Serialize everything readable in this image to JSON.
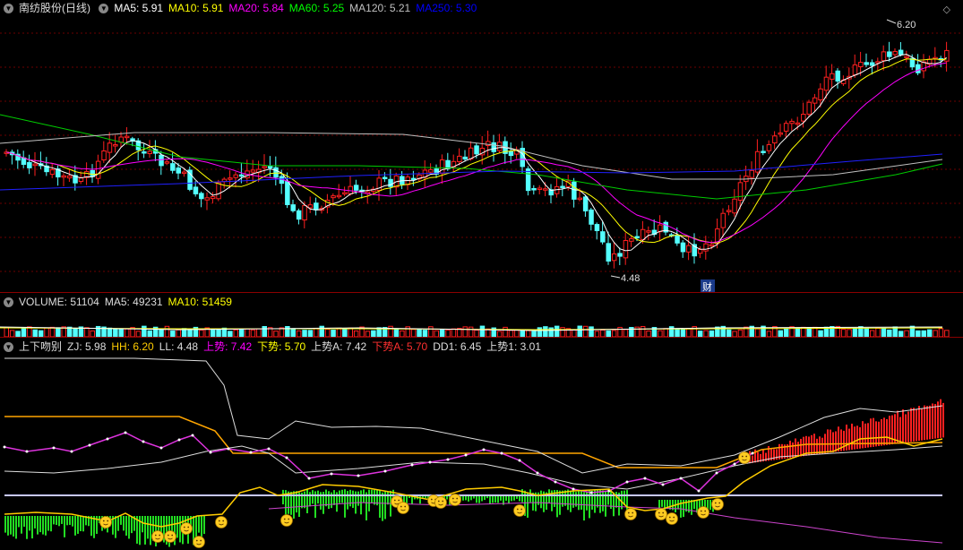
{
  "main": {
    "title": "南纺股份(日线)",
    "legend": [
      {
        "label": "MA5: 5.91",
        "color": "#ffffff"
      },
      {
        "label": "MA10: 5.91",
        "color": "#ffff00"
      },
      {
        "label": "MA20: 5.84",
        "color": "#ff00ff"
      },
      {
        "label": "MA60: 5.25",
        "color": "#00ff00"
      },
      {
        "label": "MA120: 5.21",
        "color": "#c0c0c0"
      },
      {
        "label": "MA250: 5.30",
        "color": "#0000ff"
      }
    ],
    "high_label": "6.20",
    "low_label": "4.48",
    "event_label": "财",
    "corner_icon": "diamond-icon",
    "up_color": "#ff2020",
    "down_color": "#54ffff"
  },
  "volume": {
    "legend": [
      {
        "label": "VOLUME: 51104",
        "color": "#dddddd"
      },
      {
        "label": "MA5: 49231",
        "color": "#dddddd"
      },
      {
        "label": "MA10: 51459",
        "color": "#ffff00"
      }
    ]
  },
  "indicator": {
    "legend": [
      {
        "label": "上下吻别",
        "color": "#dddddd"
      },
      {
        "label": "ZJ: 5.98",
        "color": "#dddddd"
      },
      {
        "label": "HH: 6.20",
        "color": "#ffcc00"
      },
      {
        "label": "LL: 4.48",
        "color": "#dddddd"
      },
      {
        "label": "上势: 7.42",
        "color": "#ff00ff"
      },
      {
        "label": "下势: 5.70",
        "color": "#ffff00"
      },
      {
        "label": "上势A: 7.42",
        "color": "#dddddd"
      },
      {
        "label": "下势A: 5.70",
        "color": "#ff3030"
      },
      {
        "label": "DD1: 6.45",
        "color": "#dddddd"
      },
      {
        "label": "上势1: 3.01",
        "color": "#dddddd"
      }
    ],
    "emoji_icon": "smiley-icon"
  }
}
